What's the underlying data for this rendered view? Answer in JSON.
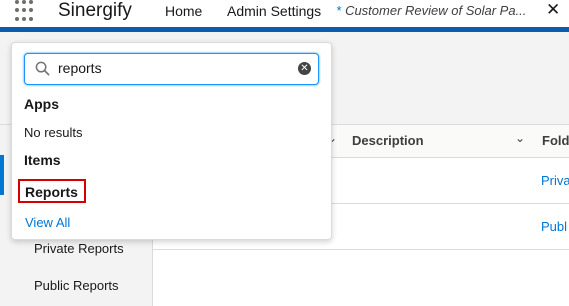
{
  "nav": {
    "app_name": "Sinergify",
    "items": [
      "Home",
      "Admin Settings"
    ],
    "active_tab": {
      "prefix": "*",
      "label": "Customer Review of Solar Pa..."
    }
  },
  "search": {
    "value": "reports",
    "groups": {
      "apps_title": "Apps",
      "apps_empty": "No results",
      "items_title": "Items",
      "items": [
        "Reports"
      ]
    },
    "view_all": "View All"
  },
  "table": {
    "columns": [
      "Description",
      "Folde"
    ],
    "rows": [
      {
        "folder": "Priva"
      },
      {
        "folder": "Publ"
      }
    ]
  },
  "sidebar": {
    "items": [
      "Private Reports",
      "Public Reports"
    ]
  },
  "colors": {
    "brand": "#0b5cab",
    "link": "#0176d3",
    "highlight": "#d40000"
  }
}
